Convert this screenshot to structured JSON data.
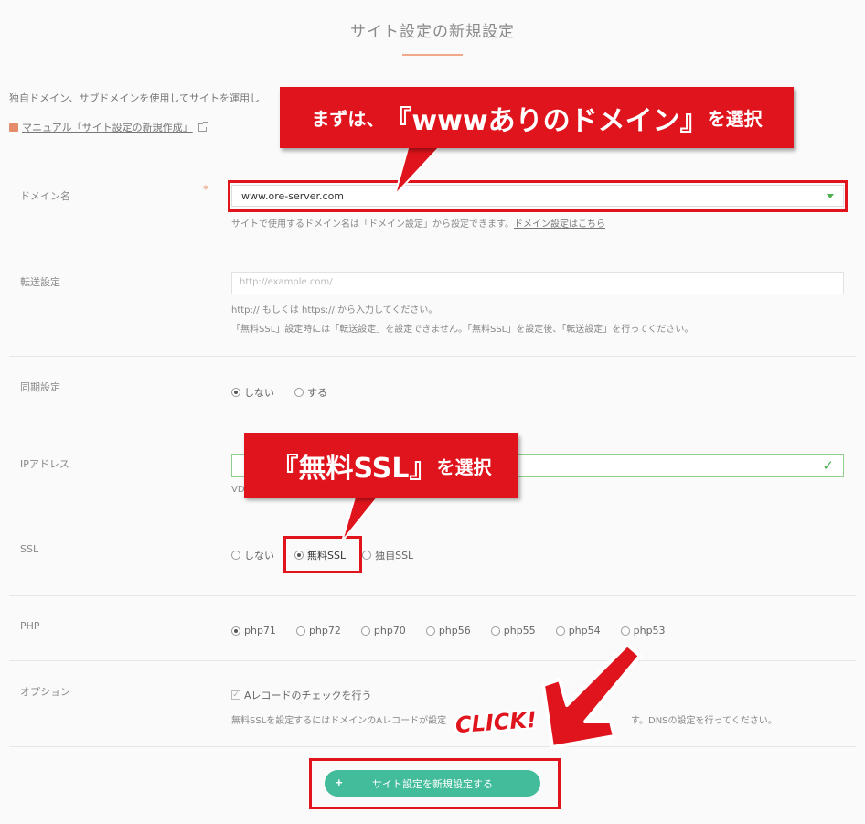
{
  "page": {
    "title": "サイト設定の新規設定",
    "intro": "独自ドメイン、サブドメインを使用してサイトを運用し",
    "manual_link": "マニュアル「サイト設定の新規作成」"
  },
  "colors": {
    "accent": "#43bc9c",
    "annotation_red": "#e0141c",
    "title_underline": "#f2a98a"
  },
  "form": {
    "domain": {
      "label": "ドメイン名",
      "required_mark": "*",
      "value": "www.ore-server.com",
      "help": "サイトで使用するドメイン名は「ドメイン設定」から設定できます。",
      "help_link": "ドメイン設定はこちら"
    },
    "redirect": {
      "label": "転送設定",
      "placeholder": "http://example.com/",
      "help1": "http:// もしくは https:// から入力してください。",
      "help2": "「無料SSL」設定時には「転送設定」を設定できません。「無料SSL」を設定後、「転送設定」を行ってください。"
    },
    "sync": {
      "label": "同期設定",
      "options": [
        "しない",
        "する"
      ],
      "selected": "しない"
    },
    "ip": {
      "label": "IPアドレス",
      "help_fragment": "VD"
    },
    "ssl": {
      "label": "SSL",
      "options": [
        "しない",
        "無料SSL",
        "独自SSL"
      ],
      "selected": "無料SSL"
    },
    "php": {
      "label": "PHP",
      "options": [
        "php71",
        "php72",
        "php70",
        "php56",
        "php55",
        "php54",
        "php53"
      ],
      "selected": "php71"
    },
    "option": {
      "label": "オプション",
      "checkbox_label": "Aレコードのチェックを行う",
      "help_left": "無料SSLを設定するにはドメインのAレコードが設定",
      "help_right": "す。DNSの設定を行ってください。"
    },
    "submit": {
      "icon": "+",
      "label": "サイト設定を新規設定する"
    }
  },
  "annotations": {
    "callout_domain": {
      "prefix": "まずは、",
      "emph": "『wwwありのドメイン』",
      "suffix": "を選択"
    },
    "callout_ssl": {
      "emph": "『無料SSL』",
      "suffix": "を選択"
    },
    "click": "CLICK!"
  }
}
